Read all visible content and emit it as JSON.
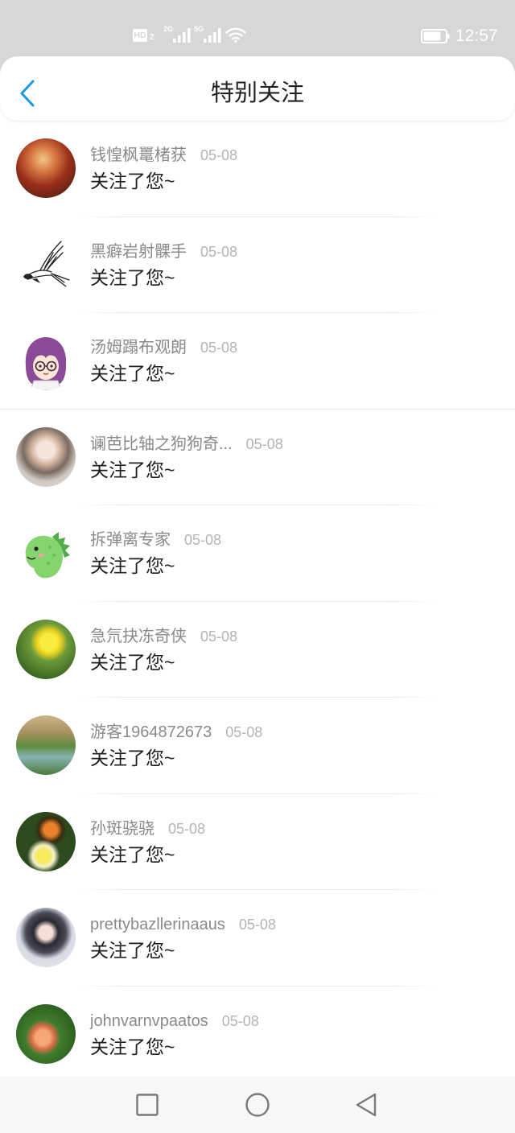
{
  "colors": {
    "accent": "#1d98ea",
    "status_bar_bg": "#d7d7d7"
  },
  "status_bar": {
    "hd_label": "HD",
    "hd_sub": "2",
    "sim1_network": "2G",
    "sim2_network": "5G",
    "time": "12:57",
    "battery_level": 0.8,
    "icons": {
      "hd": "hd-voice-icon",
      "signal": "signal-icon",
      "wifi": "wifi-icon",
      "battery": "battery-icon"
    }
  },
  "header": {
    "title": "特别关注",
    "back_icon": "chevron-left-icon"
  },
  "notifications": [
    {
      "name": "钱惶枫鼍楮获",
      "time": "05-08",
      "message": "关注了您~"
    },
    {
      "name": "黑癖岩射髁手",
      "time": "05-08",
      "message": "关注了您~"
    },
    {
      "name": "汤姆蹋布观朗",
      "time": "05-08",
      "message": "关注了您~"
    },
    {
      "name": "谰芭比轴之狗狗奇...",
      "time": "05-08",
      "message": "关注了您~"
    },
    {
      "name": "拆弹离专家",
      "time": "05-08",
      "message": "关注了您~"
    },
    {
      "name": "急氘抉冻奇侠",
      "time": "05-08",
      "message": "关注了您~"
    },
    {
      "name": "游客1964872673",
      "time": "05-08",
      "message": "关注了您~"
    },
    {
      "name": "孙斑骁骁",
      "time": "05-08",
      "message": "关注了您~"
    },
    {
      "name": "prettybazllerinaaus",
      "time": "05-08",
      "message": "关注了您~"
    },
    {
      "name": "johnvarnvpaatos",
      "time": "05-08",
      "message": "关注了您~"
    }
  ],
  "nav_bar": {
    "recents_icon": "square-icon",
    "home_icon": "circle-icon",
    "back_icon": "triangle-back-icon"
  }
}
